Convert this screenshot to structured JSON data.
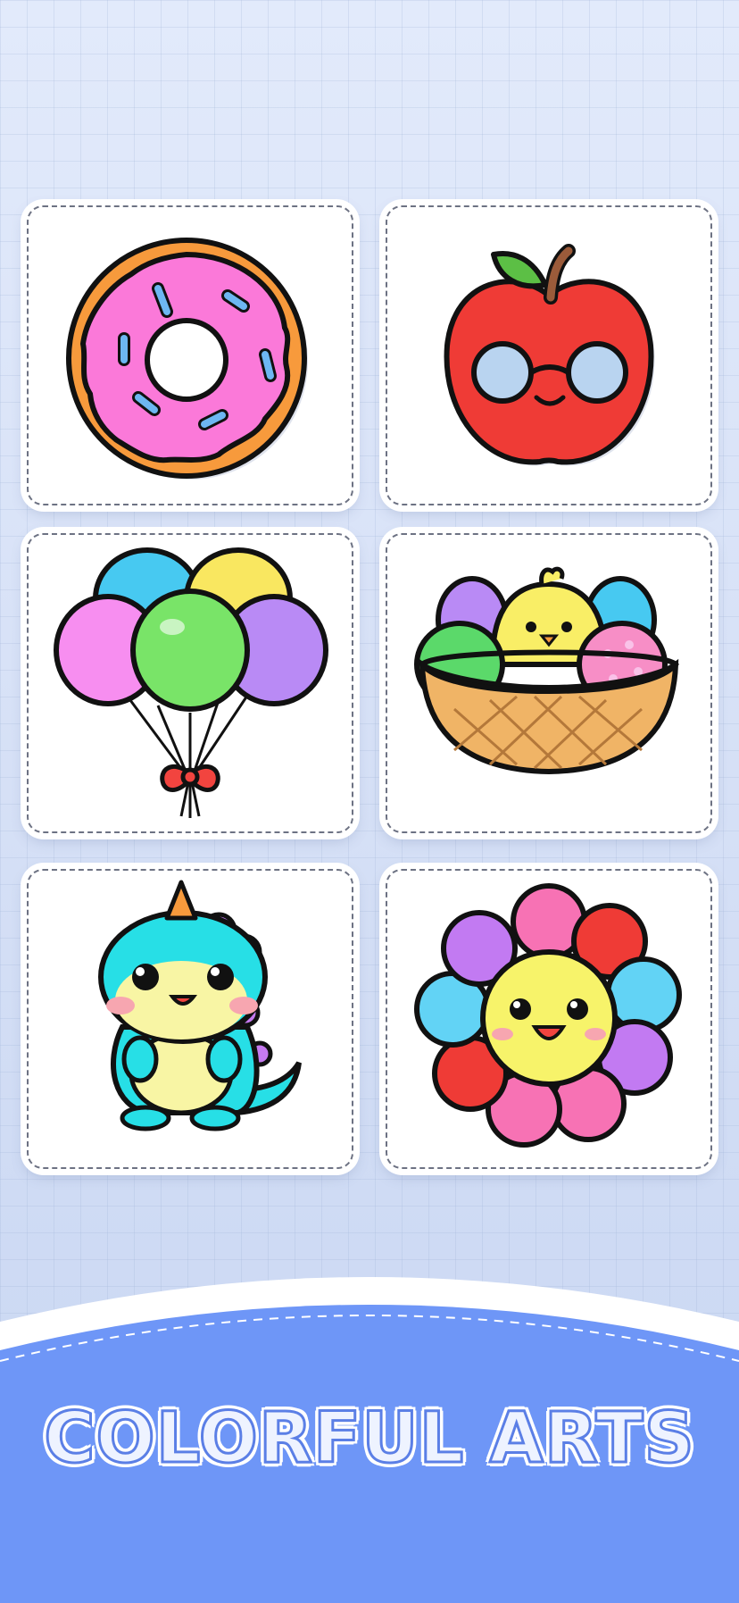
{
  "cards": [
    {
      "name": "donut"
    },
    {
      "name": "apple"
    },
    {
      "name": "balloons"
    },
    {
      "name": "chick-basket"
    },
    {
      "name": "dinosaur"
    },
    {
      "name": "flower"
    }
  ],
  "banner": {
    "title": "COLORFUL ARTS"
  },
  "colors": {
    "background": "#dfe8f8",
    "footer": "#6e96f7",
    "card": "#ffffff",
    "outline": "#111111"
  }
}
